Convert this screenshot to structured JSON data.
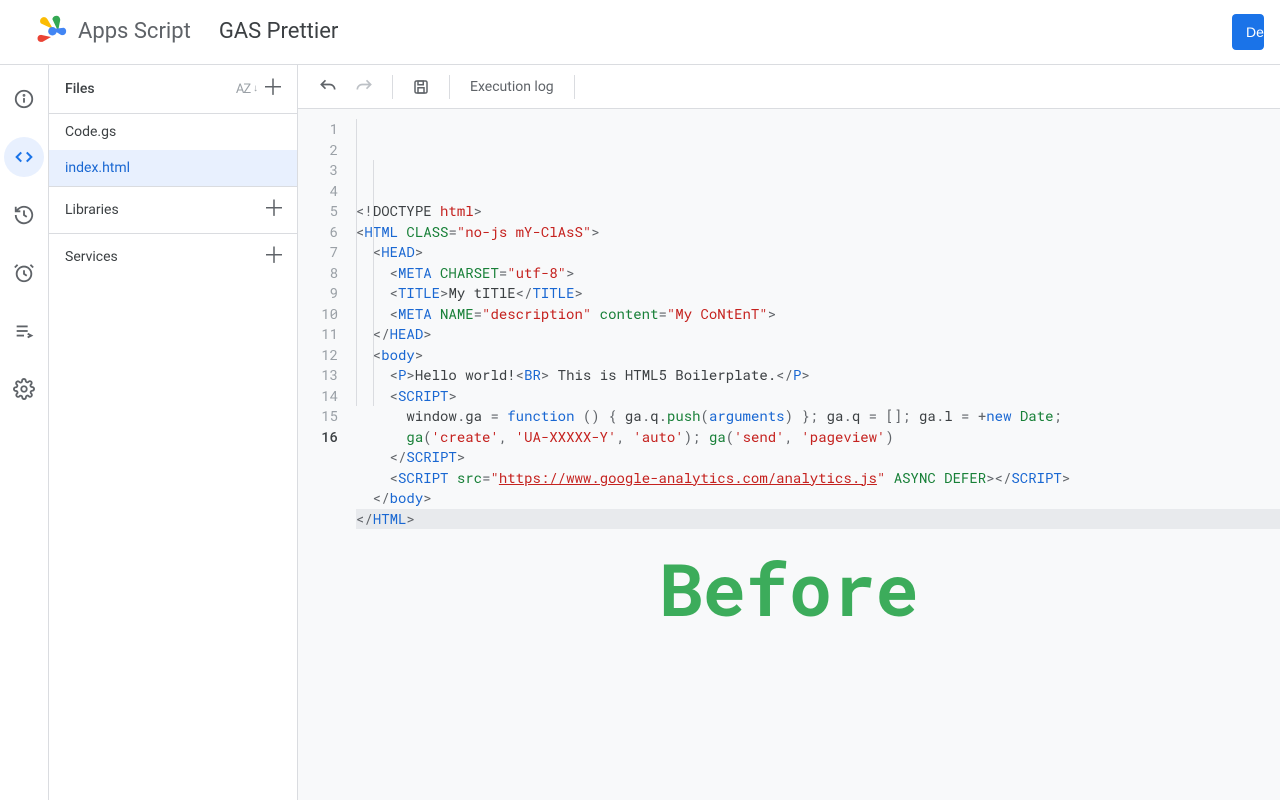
{
  "header": {
    "product": "Apps Script",
    "project_title": "GAS Prettier",
    "deploy_label": "Deploy"
  },
  "rail": {
    "items": [
      {
        "name": "overview",
        "icon": "info"
      },
      {
        "name": "editor",
        "icon": "code",
        "active": true
      },
      {
        "name": "triggers-history",
        "icon": "history"
      },
      {
        "name": "triggers",
        "icon": "alarm"
      },
      {
        "name": "executions",
        "icon": "execution-log"
      },
      {
        "name": "settings",
        "icon": "gear"
      }
    ]
  },
  "sidebar": {
    "files_label": "Files",
    "files": [
      {
        "name": "Code.gs",
        "active": false
      },
      {
        "name": "index.html",
        "active": true
      }
    ],
    "libraries_label": "Libraries",
    "services_label": "Services"
  },
  "toolbar": {
    "execution_log_label": "Execution log"
  },
  "editor": {
    "line_count": 16,
    "active_line": 16,
    "tokens": [
      [
        {
          "t": "<!",
          "c": "c-punc"
        },
        {
          "t": "DOCTYPE ",
          "c": "c-txt"
        },
        {
          "t": "html",
          "c": "c-str"
        },
        {
          "t": ">",
          "c": "c-punc"
        }
      ],
      [
        {
          "t": "<",
          "c": "c-punc"
        },
        {
          "t": "HTML",
          "c": "c-tag"
        },
        {
          "t": " ",
          "c": ""
        },
        {
          "t": "CLASS",
          "c": "c-attr"
        },
        {
          "t": "=",
          "c": "c-punc"
        },
        {
          "t": "\"no-js mY-ClAsS\"",
          "c": "c-str"
        },
        {
          "t": ">",
          "c": "c-punc"
        }
      ],
      [
        {
          "t": "  <",
          "c": "c-punc"
        },
        {
          "t": "HEAD",
          "c": "c-tag"
        },
        {
          "t": ">",
          "c": "c-punc"
        }
      ],
      [
        {
          "t": "    <",
          "c": "c-punc"
        },
        {
          "t": "META",
          "c": "c-tag"
        },
        {
          "t": " ",
          "c": ""
        },
        {
          "t": "CHARSET",
          "c": "c-attr"
        },
        {
          "t": "=",
          "c": "c-punc"
        },
        {
          "t": "\"utf-8\"",
          "c": "c-str"
        },
        {
          "t": ">",
          "c": "c-punc"
        }
      ],
      [
        {
          "t": "    <",
          "c": "c-punc"
        },
        {
          "t": "TITLE",
          "c": "c-tag"
        },
        {
          "t": ">",
          "c": "c-punc"
        },
        {
          "t": "My tITlE",
          "c": "c-txt"
        },
        {
          "t": "</",
          "c": "c-punc"
        },
        {
          "t": "TITLE",
          "c": "c-tag"
        },
        {
          "t": ">",
          "c": "c-punc"
        }
      ],
      [
        {
          "t": "    <",
          "c": "c-punc"
        },
        {
          "t": "META",
          "c": "c-tag"
        },
        {
          "t": " ",
          "c": ""
        },
        {
          "t": "NAME",
          "c": "c-attr"
        },
        {
          "t": "=",
          "c": "c-punc"
        },
        {
          "t": "\"description\"",
          "c": "c-str"
        },
        {
          "t": " ",
          "c": ""
        },
        {
          "t": "content",
          "c": "c-attr"
        },
        {
          "t": "=",
          "c": "c-punc"
        },
        {
          "t": "\"My CoNtEnT\"",
          "c": "c-str"
        },
        {
          "t": ">",
          "c": "c-punc"
        }
      ],
      [
        {
          "t": "  </",
          "c": "c-punc"
        },
        {
          "t": "HEAD",
          "c": "c-tag"
        },
        {
          "t": ">",
          "c": "c-punc"
        }
      ],
      [
        {
          "t": "  <",
          "c": "c-punc"
        },
        {
          "t": "body",
          "c": "c-tag"
        },
        {
          "t": ">",
          "c": "c-punc"
        }
      ],
      [
        {
          "t": "    <",
          "c": "c-punc"
        },
        {
          "t": "P",
          "c": "c-tag"
        },
        {
          "t": ">",
          "c": "c-punc"
        },
        {
          "t": "Hello world!",
          "c": "c-txt"
        },
        {
          "t": "<",
          "c": "c-punc"
        },
        {
          "t": "BR",
          "c": "c-tag"
        },
        {
          "t": ">",
          "c": "c-punc"
        },
        {
          "t": " This is HTML5 Boilerplate.",
          "c": "c-txt"
        },
        {
          "t": "</",
          "c": "c-punc"
        },
        {
          "t": "P",
          "c": "c-tag"
        },
        {
          "t": ">",
          "c": "c-punc"
        }
      ],
      [
        {
          "t": "    <",
          "c": "c-punc"
        },
        {
          "t": "SCRIPT",
          "c": "c-tag"
        },
        {
          "t": ">",
          "c": "c-punc"
        }
      ],
      [
        {
          "t": "      window",
          "c": "c-txt"
        },
        {
          "t": ".",
          "c": "c-punc"
        },
        {
          "t": "ga",
          "c": "c-txt"
        },
        {
          "t": " = ",
          "c": "c-punc"
        },
        {
          "t": "function",
          "c": "c-kw"
        },
        {
          "t": " () { ",
          "c": "c-punc"
        },
        {
          "t": "ga",
          "c": "c-txt"
        },
        {
          "t": ".",
          "c": "c-punc"
        },
        {
          "t": "q",
          "c": "c-txt"
        },
        {
          "t": ".",
          "c": "c-punc"
        },
        {
          "t": "push",
          "c": "c-fn"
        },
        {
          "t": "(",
          "c": "c-punc"
        },
        {
          "t": "arguments",
          "c": "c-kw"
        },
        {
          "t": ") }; ",
          "c": "c-punc"
        },
        {
          "t": "ga",
          "c": "c-txt"
        },
        {
          "t": ".",
          "c": "c-punc"
        },
        {
          "t": "q",
          "c": "c-txt"
        },
        {
          "t": " = []; ",
          "c": "c-punc"
        },
        {
          "t": "ga",
          "c": "c-txt"
        },
        {
          "t": ".",
          "c": "c-punc"
        },
        {
          "t": "l",
          "c": "c-txt"
        },
        {
          "t": " = +",
          "c": "c-punc"
        },
        {
          "t": "new",
          "c": "c-kw"
        },
        {
          "t": " ",
          "c": ""
        },
        {
          "t": "Date",
          "c": "c-fn"
        },
        {
          "t": ";",
          "c": "c-punc"
        }
      ],
      [
        {
          "t": "      ",
          "c": ""
        },
        {
          "t": "ga",
          "c": "c-fn"
        },
        {
          "t": "(",
          "c": "c-punc"
        },
        {
          "t": "'create'",
          "c": "c-str"
        },
        {
          "t": ", ",
          "c": "c-punc"
        },
        {
          "t": "'UA-XXXXX-Y'",
          "c": "c-str"
        },
        {
          "t": ", ",
          "c": "c-punc"
        },
        {
          "t": "'auto'",
          "c": "c-str"
        },
        {
          "t": "); ",
          "c": "c-punc"
        },
        {
          "t": "ga",
          "c": "c-fn"
        },
        {
          "t": "(",
          "c": "c-punc"
        },
        {
          "t": "'send'",
          "c": "c-str"
        },
        {
          "t": ", ",
          "c": "c-punc"
        },
        {
          "t": "'pageview'",
          "c": "c-str"
        },
        {
          "t": ")",
          "c": "c-punc"
        }
      ],
      [
        {
          "t": "    </",
          "c": "c-punc"
        },
        {
          "t": "SCRIPT",
          "c": "c-tag"
        },
        {
          "t": ">",
          "c": "c-punc"
        }
      ],
      [
        {
          "t": "    <",
          "c": "c-punc"
        },
        {
          "t": "SCRIPT",
          "c": "c-tag"
        },
        {
          "t": " ",
          "c": ""
        },
        {
          "t": "src",
          "c": "c-attr"
        },
        {
          "t": "=",
          "c": "c-punc"
        },
        {
          "t": "\"",
          "c": "c-str"
        },
        {
          "t": "https://www.google-analytics.com/analytics.js",
          "c": "c-link"
        },
        {
          "t": "\"",
          "c": "c-str"
        },
        {
          "t": " ",
          "c": ""
        },
        {
          "t": "ASYNC",
          "c": "c-attr"
        },
        {
          "t": " ",
          "c": ""
        },
        {
          "t": "DEFER",
          "c": "c-attr"
        },
        {
          "t": "></",
          "c": "c-punc"
        },
        {
          "t": "SCRIPT",
          "c": "c-tag"
        },
        {
          "t": ">",
          "c": "c-punc"
        }
      ],
      [
        {
          "t": "  </",
          "c": "c-punc"
        },
        {
          "t": "body",
          "c": "c-tag"
        },
        {
          "t": ">",
          "c": "c-punc"
        }
      ],
      [
        {
          "t": "</",
          "c": "c-punc"
        },
        {
          "t": "HTML",
          "c": "c-tag"
        },
        {
          "t": ">",
          "c": "c-punc"
        }
      ]
    ]
  },
  "overlay": {
    "label": "Before"
  }
}
